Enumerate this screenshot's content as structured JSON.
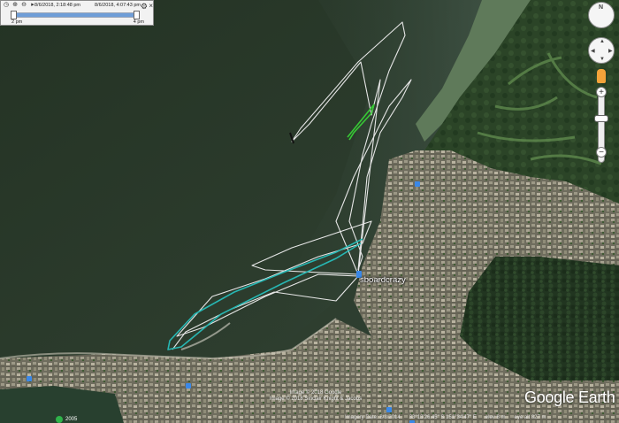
{
  "timebar": {
    "range_start": "8/6/2018, 2:18:48 pm",
    "range_end": "8/6/2018, 4:07:43 pm",
    "label_left": "2 pm",
    "label_right": "4 pm",
    "icons": [
      "clock-icon",
      "zoom-in-icon",
      "zoom-out-icon",
      "play-icon"
    ]
  },
  "map": {
    "place_label": "sboardcrazy",
    "logo": "Google Earth",
    "copyright": [
      "Image © 2018 Google",
      "Image © 2018 Sinclair Knight & Jacobs"
    ],
    "historical_year": "2005",
    "status": {
      "imagery_date": "Imagery Date: 8/3/2014",
      "coordinates": "33°13'26.45\" S 151°34'47\" E",
      "elevation": "elev 8 m",
      "eye_alt": "eye alt 827 m"
    }
  },
  "colors": {
    "water": "#2b3b2d",
    "land_urban": "#7a7a68",
    "track_white": "#e6e6e6",
    "track_teal": "#27b7b3",
    "track_green": "#37c935"
  }
}
